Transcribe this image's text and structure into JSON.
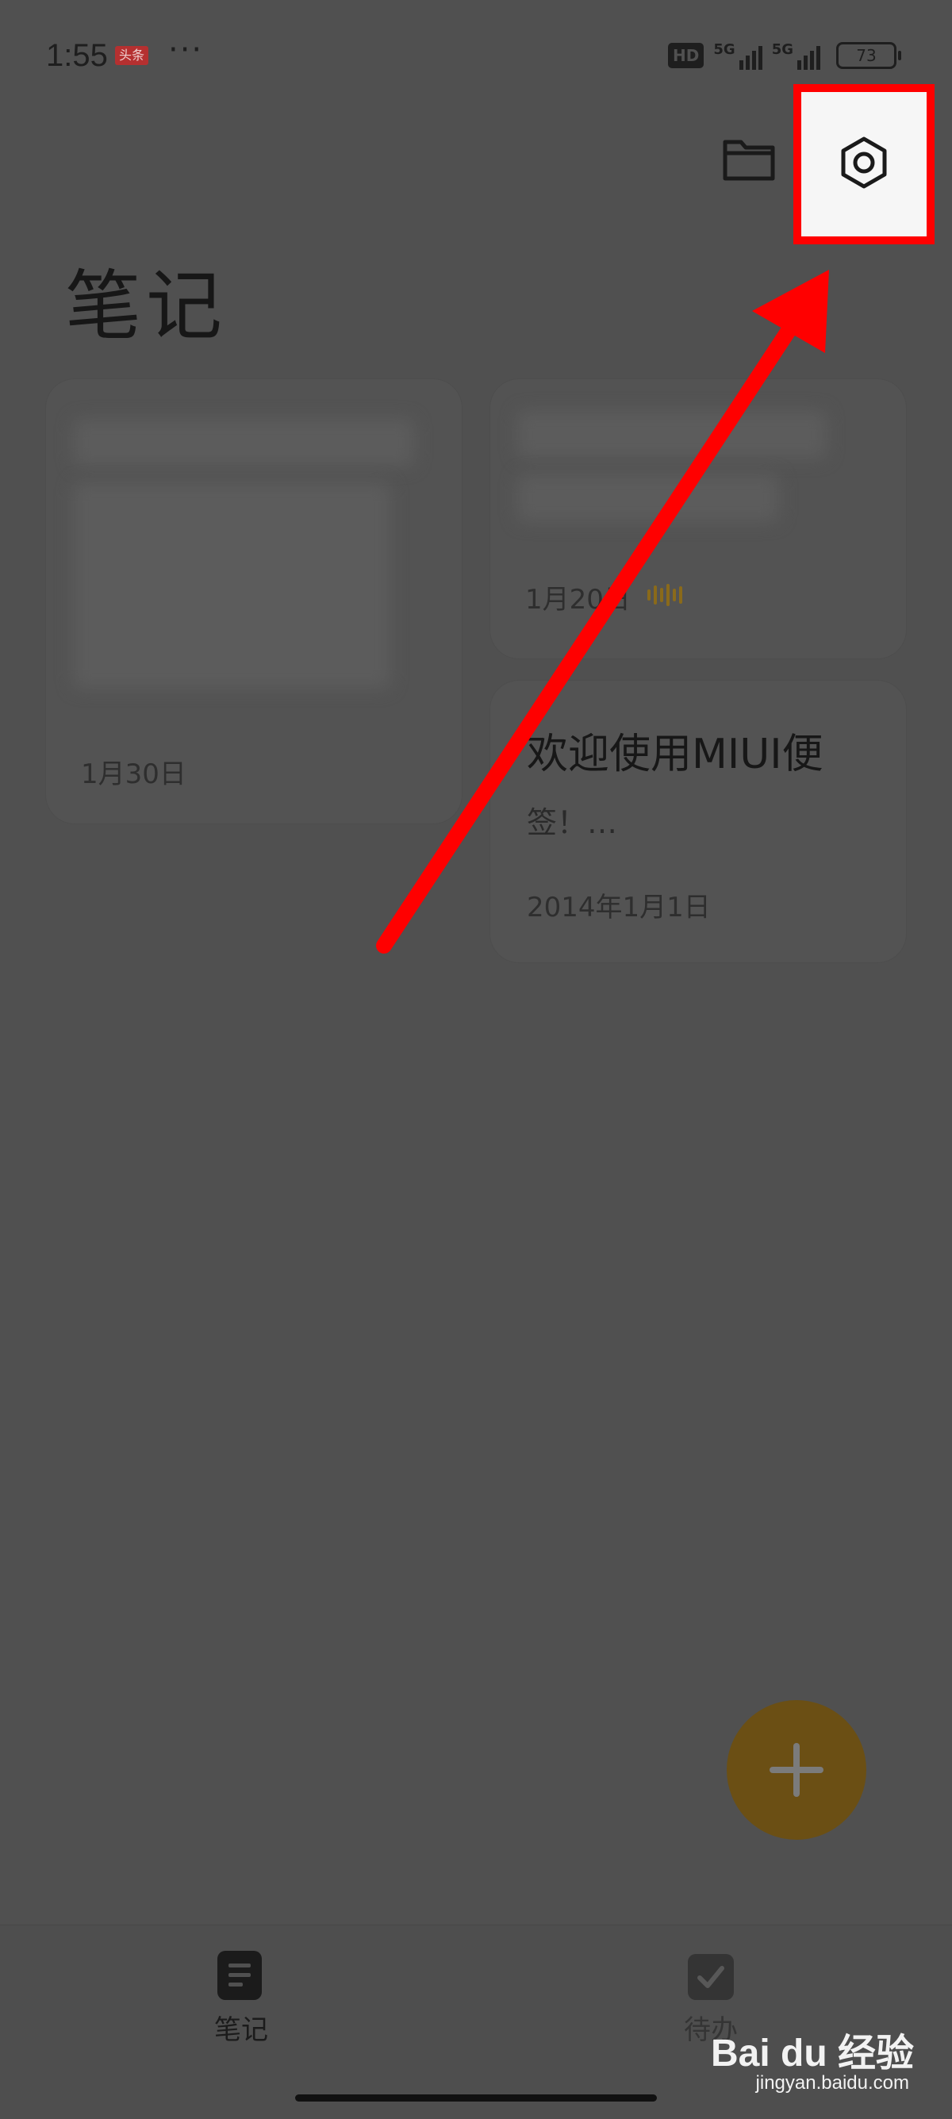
{
  "status_bar": {
    "time": "1:55",
    "app_badge": "头条",
    "more_dots": "···",
    "hd_label": "HD",
    "network_1": "5G",
    "network_2": "5G",
    "battery": "73"
  },
  "header": {
    "folder_icon": "folder-icon",
    "settings_icon": "settings-icon",
    "title": "笔记"
  },
  "notes": [
    {
      "date": "1月30日"
    },
    {
      "date": "1月20日",
      "has_audio": true
    },
    {
      "title": "欢迎使用MIUI便",
      "body": "签！…",
      "date": "2014年1月1日"
    }
  ],
  "fab": {
    "icon": "plus-icon"
  },
  "bottom_nav": {
    "items": [
      {
        "label": "笔记",
        "icon": "notes-icon",
        "active": true
      },
      {
        "label": "待办",
        "icon": "checkbox-icon",
        "active": false
      }
    ]
  },
  "watermark": {
    "main": "Bai du 经验",
    "sub": "jingyan.baidu.com"
  },
  "colors": {
    "overlay": "#505050",
    "highlight_border": "#ff0000",
    "fab": "#6b4f14"
  }
}
